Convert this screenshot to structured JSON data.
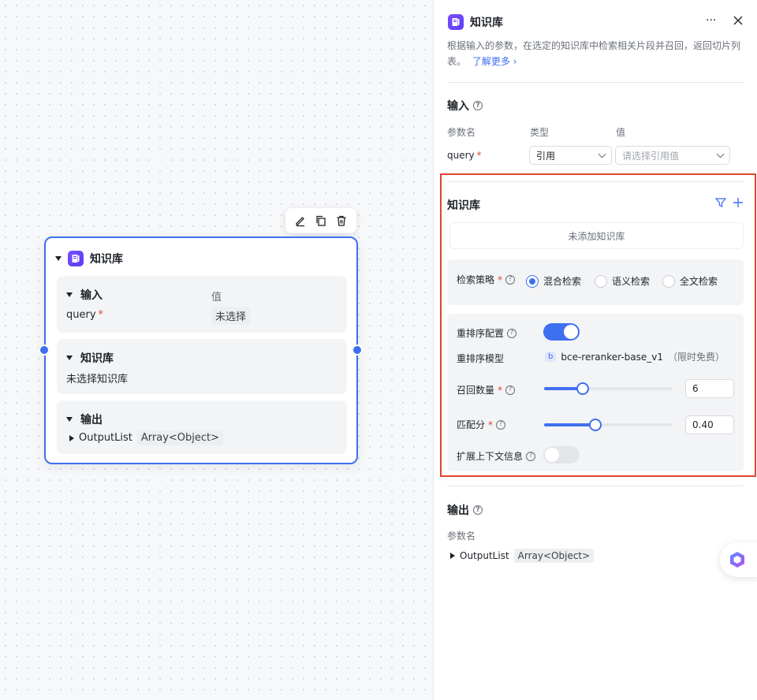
{
  "node": {
    "title": "知识库",
    "input_section": {
      "title": "输入",
      "value_header": "值",
      "param": "query",
      "required_mark": "*",
      "value": "未选择"
    },
    "kb_section": {
      "title": "知识库",
      "empty_text": "未选择知识库"
    },
    "output_section": {
      "title": "输出",
      "param": "OutputList",
      "type": "Array<Object>"
    }
  },
  "toolbar": {
    "icons": [
      "edit-icon",
      "copy-icon",
      "delete-icon"
    ]
  },
  "panel": {
    "title": "知识库",
    "more": "···",
    "description": "根据输入的参数，在选定的知识库中检索相关片段并召回，返回切片列表。",
    "learn_more": "了解更多",
    "input": {
      "title": "输入",
      "col_name": "参数名",
      "col_type": "类型",
      "col_value": "值",
      "param": "query",
      "required_mark": "*",
      "type_value": "引用",
      "value_placeholder": "请选择引用值"
    },
    "kb": {
      "title": "知识库",
      "empty": "未添加知识库",
      "strategy_label": "检索策略",
      "strategies": [
        "混合检索",
        "语义检索",
        "全文检索"
      ],
      "selected_strategy": 0,
      "rerank_config_label": "重排序配置",
      "rerank_enabled": true,
      "rerank_model_label": "重排序模型",
      "rerank_model_badge": "b",
      "rerank_model": "bce-reranker-base_v1",
      "rerank_model_note": "（限时免费）",
      "recall_label": "召回数量",
      "recall_value": "6",
      "recall_fraction": 0.3,
      "score_label": "匹配分",
      "score_value": "0.40",
      "score_fraction": 0.4,
      "context_label": "扩展上下文信息",
      "context_enabled": false
    },
    "output": {
      "title": "输出",
      "col_name": "参数名",
      "param": "OutputList",
      "type": "Array<Object>"
    }
  },
  "colors": {
    "accent": "#3f6ff1",
    "highlight_frame": "#e0452f",
    "brand": "#6a45f5"
  }
}
